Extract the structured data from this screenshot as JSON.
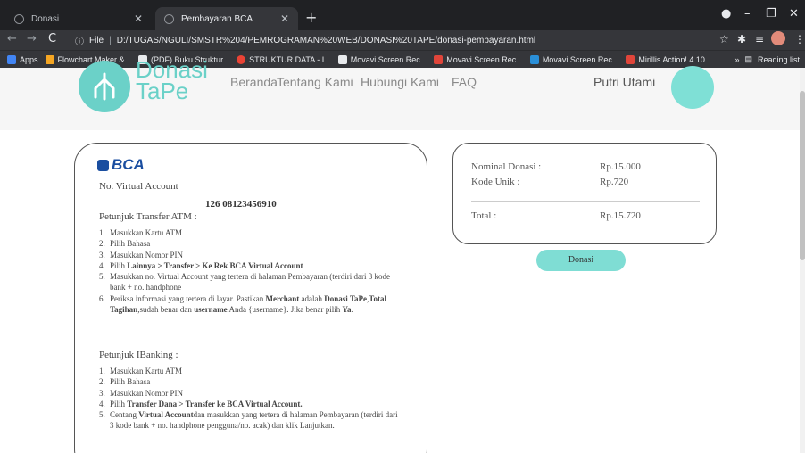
{
  "browser": {
    "tabs": [
      {
        "title": "Donasi",
        "active": false
      },
      {
        "title": "Pembayaran BCA",
        "active": true
      }
    ],
    "url_prefix": "File",
    "url": "D:/TUGAS/NGULI/SMSTR%204/PEMROGRAMAN%20WEB/DONASI%20TAPE/donasi-pembayaran.html",
    "bookmarks": [
      {
        "label": "Apps",
        "color": "#4285f4"
      },
      {
        "label": "Flowchart Maker &...",
        "color": "#f5a623"
      },
      {
        "label": "(PDF) Buku Struktur...",
        "color": "#e8eaed"
      },
      {
        "label": "STRUKTUR DATA - I...",
        "color": "#ea4335"
      },
      {
        "label": "Movavi Screen Rec...",
        "color": "#e8eaed"
      },
      {
        "label": "Movavi Screen Rec...",
        "color": "#e0453a"
      },
      {
        "label": "Movavi Screen Rec...",
        "color": "#2a8fd8"
      },
      {
        "label": "Mirillis Action! 4.10...",
        "color": "#e0453a"
      }
    ],
    "reading_list": "Reading list"
  },
  "site": {
    "logo_line1": "Donasi",
    "logo_line2": "TaPe",
    "nav": [
      "Beranda",
      "Tentang Kami",
      "Hubungi Kami",
      "FAQ"
    ],
    "user": "Putri Utami"
  },
  "payment": {
    "bank": "BCA",
    "va_label": "No. Virtual Account",
    "va_number": "126 08123456910",
    "atm_title": "Petunjuk Transfer ATM :",
    "atm_steps": [
      {
        "n": "1.",
        "html": "Masukkan Kartu ATM"
      },
      {
        "n": "2.",
        "html": "Pilih Bahasa"
      },
      {
        "n": "3.",
        "html": "Masukkan Nomor PIN"
      },
      {
        "n": "4.",
        "html": "Pilih <b>Lainnya > Transfer > Ke Rek BCA Virtual Account</b>"
      },
      {
        "n": "5.",
        "html": "Masukkan no. Virtual Account yang tertera di halaman Pembayaran (terdiri dari 3 kode bank + no. handphone"
      },
      {
        "n": "6.",
        "html": "Periksa informasi yang tertera di layar. Pastikan <b>Merchant</b> adalah <b>Donasi TaPe</b>,<b>Total Tagihan</b>,sudah benar dan <b>username</b> Anda {username}. Jika benar pilih <b>Ya</b>."
      }
    ],
    "ib_title": "Petunjuk IBanking :",
    "ib_steps": [
      {
        "n": "1.",
        "html": "Masukkan Kartu ATM"
      },
      {
        "n": "2.",
        "html": "Pilih Bahasa"
      },
      {
        "n": "3.",
        "html": "Masukkan Nomor PIN"
      },
      {
        "n": "4.",
        "html": "Pilih <b>Transfer Dana > Transfer ke BCA Virtual Account.</b>"
      },
      {
        "n": "5.",
        "html": "Centang <b>Virtual Account</b>dan masukkan yang tertera di halaman Pembayaran (terdiri dari 3 kode bank + no. handphone pengguna/no. acak) dan klik Lanjutkan."
      }
    ]
  },
  "summary": {
    "nominal_label": "Nominal Donasi :",
    "nominal_value": "Rp.15.000",
    "kode_label": "Kode Unik :",
    "kode_value": "Rp.720",
    "total_label": "Total :",
    "total_value": "Rp.15.720"
  },
  "button": {
    "donasi": "Donasi"
  },
  "colors": {
    "accent": "#6bd1c8",
    "bca_blue": "#1a4ea0"
  }
}
